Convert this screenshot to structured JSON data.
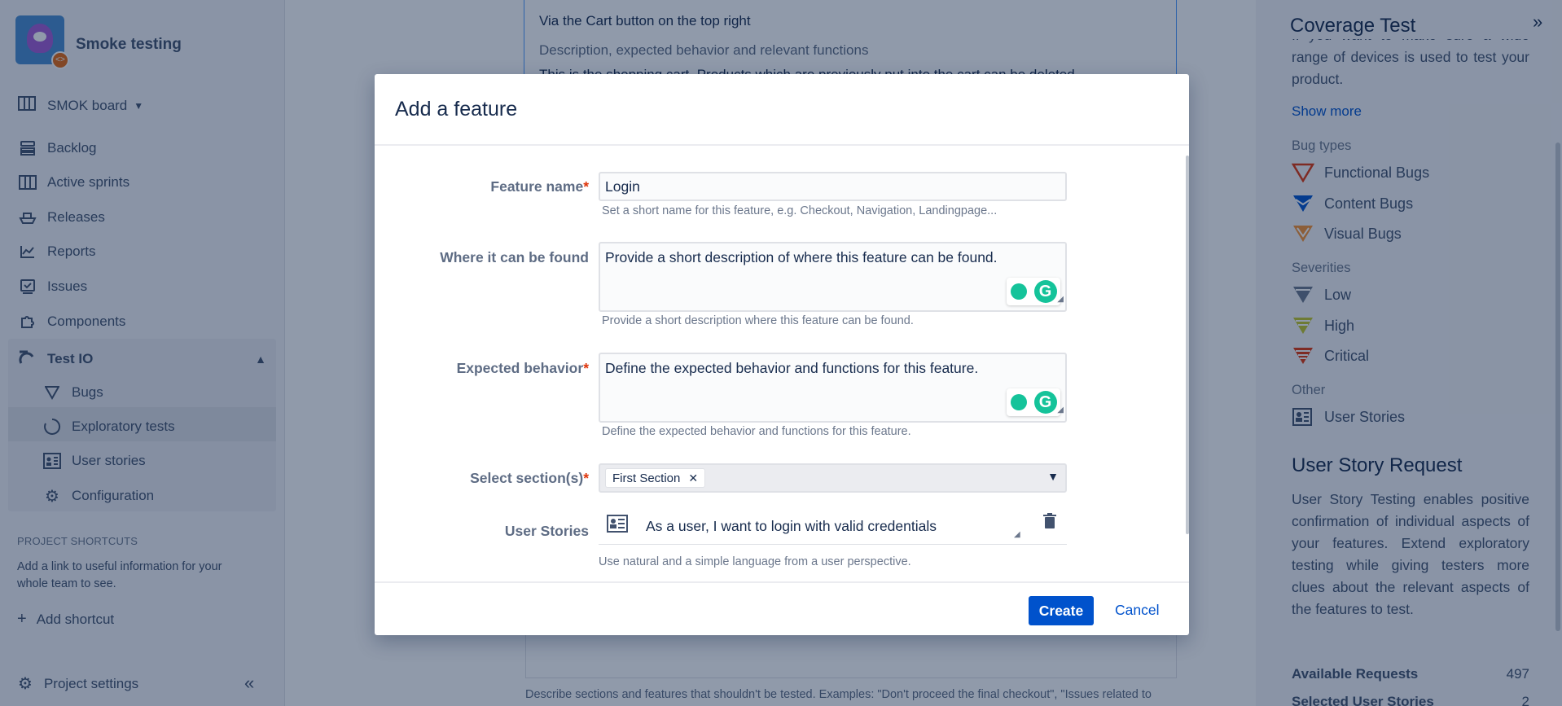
{
  "project": {
    "name": "Smoke testing"
  },
  "sidebar": {
    "board": "SMOK board",
    "items": [
      {
        "label": "Backlog",
        "icon": "backlog-icon"
      },
      {
        "label": "Active sprints",
        "icon": "board-icon"
      },
      {
        "label": "Releases",
        "icon": "ship-icon"
      },
      {
        "label": "Reports",
        "icon": "chart-icon"
      },
      {
        "label": "Issues",
        "icon": "issues-icon"
      },
      {
        "label": "Components",
        "icon": "puzzle-icon"
      }
    ],
    "testio": {
      "label": "Test IO",
      "items": [
        {
          "label": "Bugs"
        },
        {
          "label": "Exploratory tests"
        },
        {
          "label": "User stories"
        },
        {
          "label": "Configuration"
        }
      ]
    },
    "shortcuts_title": "PROJECT SHORTCUTS",
    "shortcuts_desc": "Add a link to useful information for your whole team to see.",
    "add_shortcut": "Add shortcut",
    "project_settings": "Project settings"
  },
  "main": {
    "text1": "Via the Cart button on the top right",
    "text2": "Description, expected behavior and relevant functions",
    "text3": "This is the shopping cart. Products which are previously put into the cart can be deleted",
    "text4": "Describe sections and features that shouldn't be tested. Examples: \"Don't proceed the final checkout\", \"Issues related to"
  },
  "right_panel": {
    "title": "Coverage Test",
    "cut_text": "If you want to make sure a wide range of devices is used to test your product.",
    "show_more": "Show more",
    "bug_types_title": "Bug types",
    "bug_types": [
      "Functional Bugs",
      "Content Bugs",
      "Visual Bugs"
    ],
    "severities_title": "Severities",
    "severities": [
      "Low",
      "High",
      "Critical"
    ],
    "other_title": "Other",
    "other": [
      "User Stories"
    ],
    "usr_title": "User Story Request",
    "usr_text": "User Story Testing enables positive confirmation of individual aspects of your features. Extend exploratory testing while giving testers more clues about the relevant aspects of the features to test.",
    "available_label": "Available Requests",
    "available_value": "497",
    "selected_label": "Selected User Stories",
    "selected_value": "2"
  },
  "modal": {
    "title": "Add a feature",
    "feature_name_label": "Feature name",
    "feature_name_value": "Login",
    "feature_name_hint": "Set a short name for this feature, e.g. Checkout, Navigation, Landingpage...",
    "where_label": "Where it can be found",
    "where_placeholder": "Provide a short description of where this feature can be found.",
    "where_hint": "Provide a short description where this feature can be found.",
    "expected_label": "Expected behavior",
    "expected_placeholder": "Define the expected behavior and functions for this feature.",
    "expected_hint": "Define the expected behavior and functions for this feature.",
    "sections_label": "Select section(s)",
    "sections_selected": "First Section",
    "user_stories_label": "User Stories",
    "user_story_value": "As a user, I want to login with valid credentials",
    "user_stories_hint": "Use natural and a simple language from a user perspective.",
    "required_mark": "*",
    "create": "Create",
    "cancel": "Cancel"
  }
}
